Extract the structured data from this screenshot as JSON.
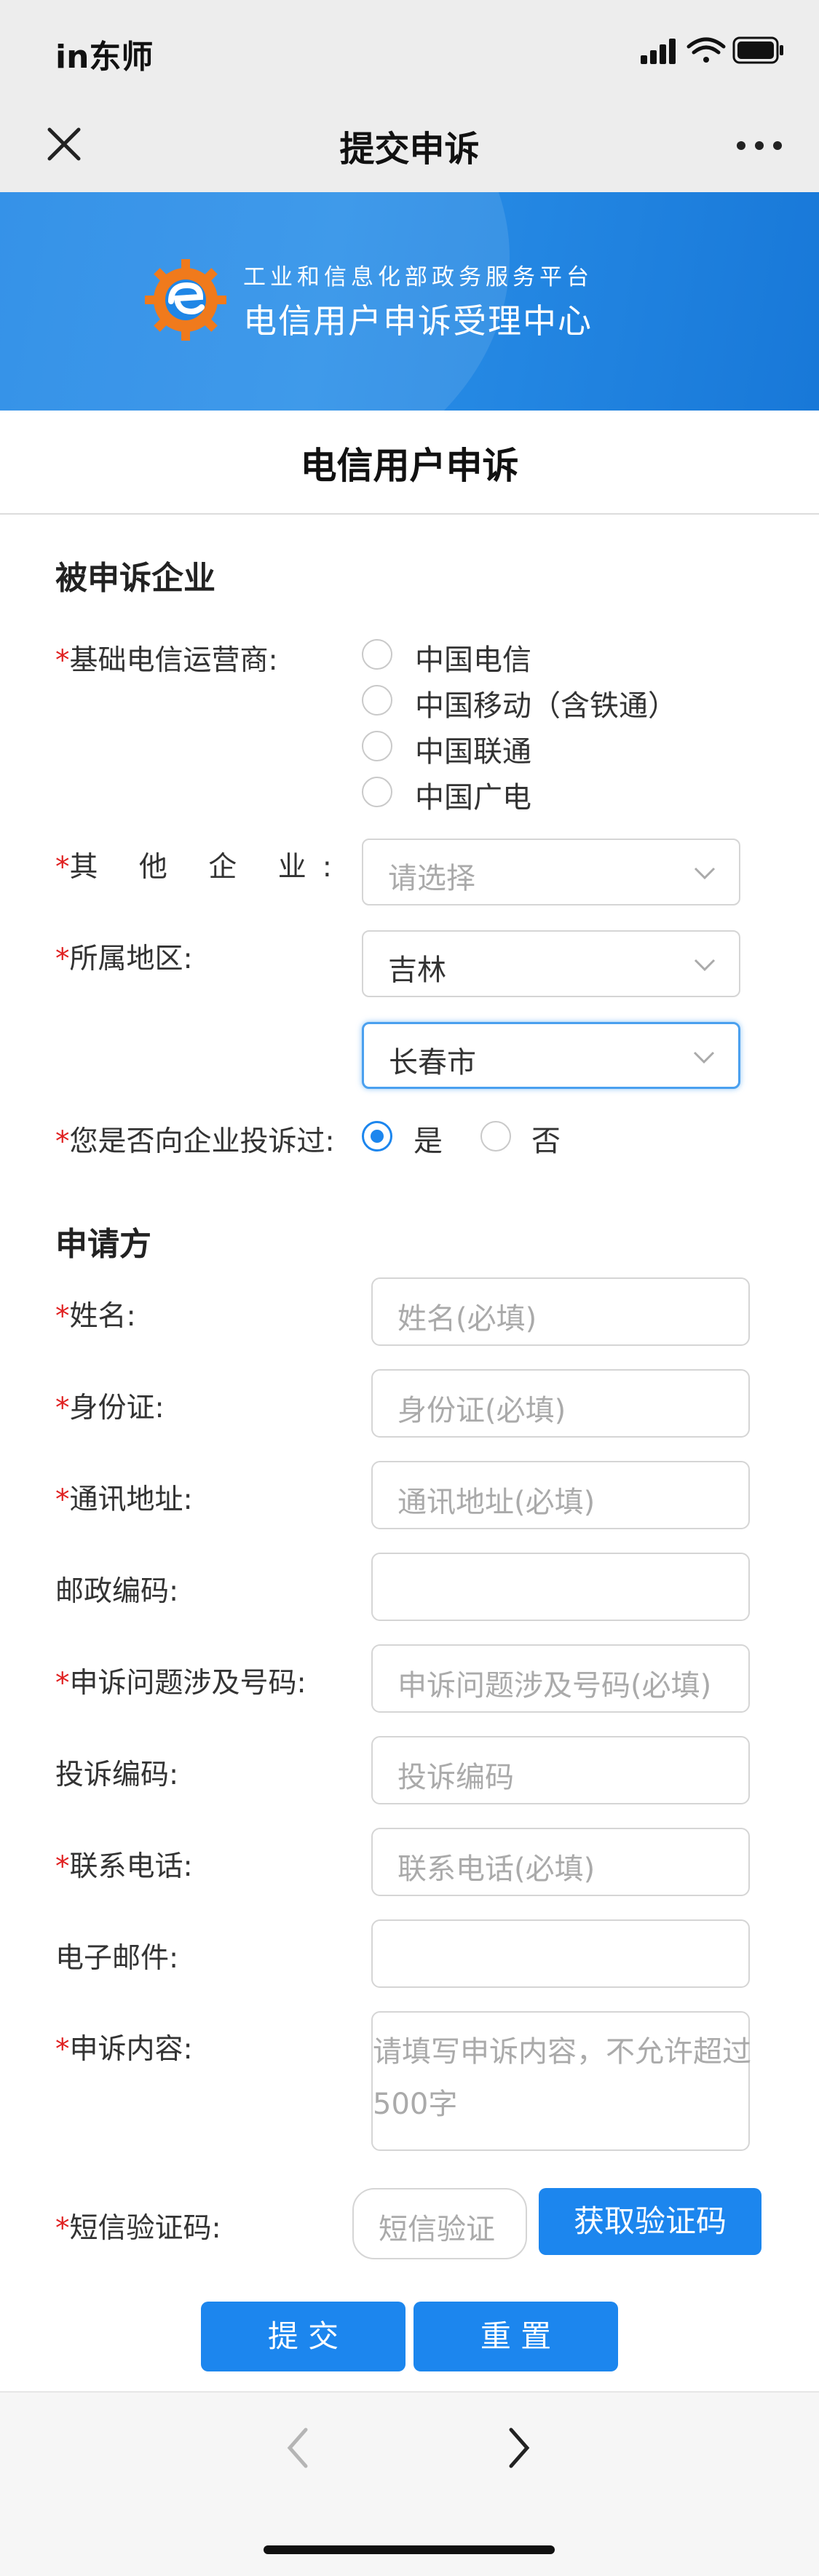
{
  "status_bar": {
    "carrier": "in东师"
  },
  "nav": {
    "title": "提交申诉",
    "close_icon": "close-icon",
    "more_icon": "more-icon"
  },
  "banner": {
    "subtitle": "工业和信息化部政务服务平台",
    "title": "电信用户申诉受理中心"
  },
  "form_title": "电信用户申诉",
  "section_company": {
    "heading": "被申诉企业",
    "operator_label": "基础电信运营商:",
    "operators": [
      "中国电信",
      "中国移动（含铁通）",
      "中国联通",
      "中国广电"
    ],
    "other_label": "其 他 企 业:",
    "other_placeholder": "请选择",
    "region_label": "所属地区:",
    "province": "吉林",
    "city": "长春市",
    "complained_label": "您是否向企业投诉过:",
    "yes": "是",
    "no": "否",
    "complained_value": "是"
  },
  "section_applicant": {
    "heading": "申请方",
    "fields": [
      {
        "label": "姓名:",
        "required": true,
        "placeholder": "姓名(必填)"
      },
      {
        "label": "身份证:",
        "required": true,
        "placeholder": "身份证(必填)"
      },
      {
        "label": "通讯地址:",
        "required": true,
        "placeholder": "通讯地址(必填)"
      },
      {
        "label": "邮政编码:",
        "required": false,
        "placeholder": ""
      },
      {
        "label": "申诉问题涉及号码:",
        "required": true,
        "placeholder": "申诉问题涉及号码(必填)"
      },
      {
        "label": "投诉编码:",
        "required": false,
        "placeholder": "投诉编码"
      },
      {
        "label": "联系电话:",
        "required": true,
        "placeholder": "联系电话(必填)"
      },
      {
        "label": "电子邮件:",
        "required": false,
        "placeholder": ""
      }
    ],
    "content_label": "申诉内容:",
    "content_placeholder": "请填写申诉内容，不允许超过500字",
    "sms_label": "短信验证码:",
    "sms_placeholder": "短信验证",
    "get_code": "获取验证码"
  },
  "actions": {
    "submit": "提 交",
    "reset": "重 置"
  },
  "bottom_nav": {
    "back_icon": "chevron-left-icon",
    "forward_icon": "chevron-right-icon"
  },
  "colors": {
    "accent": "#1c86ee",
    "required": "#e02020",
    "banner": "#1f86e6"
  }
}
